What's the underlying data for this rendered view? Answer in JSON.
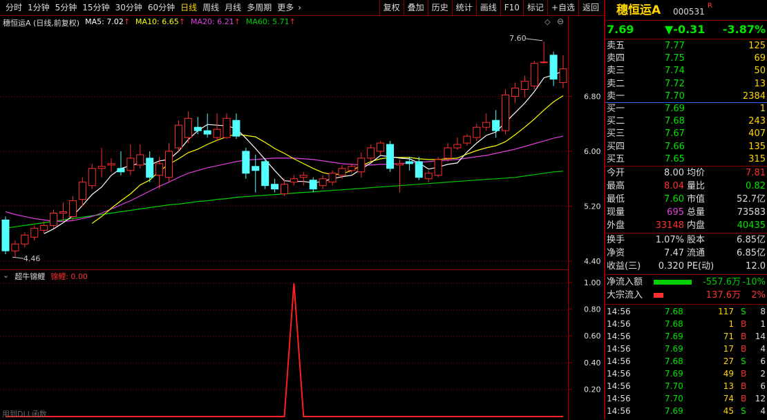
{
  "toolbar": {
    "periods": [
      "分时",
      "1分钟",
      "5分钟",
      "15分钟",
      "30分钟",
      "60分钟",
      "日线",
      "周线",
      "月线",
      "多周期",
      "更多"
    ],
    "active": "日线",
    "buttons": [
      "复权",
      "叠加",
      "历史",
      "统计",
      "画线",
      "F10",
      "标记",
      "+自选",
      "返回"
    ]
  },
  "main_legend": {
    "title": "穗恒运A (日线,前复权)",
    "ma5": "MA5: 7.02",
    "ma10": "MA10: 6.65",
    "ma20": "MA20: 6.21",
    "ma60": "MA60: 5.71",
    "arrow": "↑"
  },
  "sub_legend": {
    "title": "超牛锦鲤",
    "value": "锦鲤: 0.00"
  },
  "watermark": "用到DLL函数",
  "colors": {
    "up": "#ff3030",
    "down": "#54ffff",
    "ma5": "#ffffff",
    "ma10": "#ffff00",
    "ma20": "#e040e0",
    "ma60": "#00d000",
    "grid": "#8b0000"
  },
  "chart_data": [
    {
      "type": "candlestick",
      "title": "穗恒运A (日线,前复权)",
      "yticks": [
        6.8,
        6.0,
        5.2,
        4.4
      ],
      "ylim": [
        4.3,
        7.75
      ],
      "annotations": [
        {
          "label": "7.60"
        },
        {
          "label": "4.46"
        }
      ],
      "candles": [
        [
          5.0,
          4.55,
          5.05,
          4.5
        ],
        [
          4.55,
          4.65,
          4.7,
          4.46
        ],
        [
          4.65,
          4.78,
          4.82,
          4.6
        ],
        [
          4.75,
          4.88,
          4.92,
          4.7
        ],
        [
          4.85,
          4.92,
          4.98,
          4.8
        ],
        [
          4.92,
          5.1,
          5.15,
          4.88
        ],
        [
          5.1,
          5.12,
          5.25,
          5.0
        ],
        [
          5.05,
          5.28,
          5.35,
          5.0
        ],
        [
          5.3,
          5.55,
          5.62,
          5.2
        ],
        [
          5.5,
          5.75,
          5.82,
          5.45
        ],
        [
          5.75,
          5.78,
          6.05,
          5.62
        ],
        [
          5.8,
          5.82,
          5.9,
          5.7
        ],
        [
          5.75,
          5.7,
          6.0,
          5.65
        ],
        [
          5.72,
          5.9,
          6.1,
          5.65
        ],
        [
          5.8,
          5.95,
          6.1,
          5.75
        ],
        [
          5.9,
          5.62,
          6.0,
          5.55
        ],
        [
          5.65,
          5.82,
          5.92,
          5.45
        ],
        [
          5.62,
          6.0,
          6.12,
          5.55
        ],
        [
          6.05,
          6.38,
          6.45,
          6.0
        ],
        [
          6.2,
          6.48,
          6.58,
          6.12
        ],
        [
          6.35,
          6.3,
          6.5,
          6.25
        ],
        [
          6.3,
          6.25,
          6.55,
          6.2
        ],
        [
          6.2,
          6.32,
          6.55,
          6.15
        ],
        [
          6.2,
          6.48,
          6.55,
          6.18
        ],
        [
          6.45,
          6.22,
          6.55,
          6.18
        ],
        [
          6.0,
          5.68,
          6.05,
          5.6
        ],
        [
          5.78,
          5.72,
          5.95,
          5.4
        ],
        [
          5.85,
          5.5,
          5.9,
          5.45
        ],
        [
          5.52,
          5.45,
          5.6,
          5.4
        ],
        [
          5.38,
          5.52,
          5.6,
          5.35
        ],
        [
          5.55,
          5.6,
          5.65,
          5.5
        ],
        [
          5.62,
          5.65,
          5.7,
          5.5
        ],
        [
          5.58,
          5.45,
          5.62,
          5.4
        ],
        [
          5.5,
          5.6,
          5.65,
          5.45
        ],
        [
          5.55,
          5.68,
          5.72,
          5.5
        ],
        [
          5.65,
          5.75,
          5.8,
          5.6
        ],
        [
          5.72,
          5.78,
          5.82,
          5.68
        ],
        [
          5.7,
          5.9,
          5.98,
          5.62
        ],
        [
          5.9,
          6.05,
          6.1,
          5.85
        ],
        [
          6.0,
          6.12,
          6.15,
          5.95
        ],
        [
          6.1,
          5.75,
          6.15,
          5.7
        ],
        [
          5.8,
          5.82,
          5.88,
          5.4
        ],
        [
          5.85,
          5.82,
          5.92,
          5.72
        ],
        [
          5.85,
          5.62,
          5.92,
          5.58
        ],
        [
          5.6,
          5.68,
          5.72,
          5.55
        ],
        [
          5.65,
          5.88,
          5.92,
          5.62
        ],
        [
          5.9,
          6.05,
          6.12,
          5.85
        ],
        [
          6.05,
          6.1,
          6.2,
          6.02
        ],
        [
          6.12,
          6.22,
          6.25,
          6.08
        ],
        [
          6.2,
          6.35,
          6.4,
          6.15
        ],
        [
          6.35,
          6.42,
          6.55,
          6.3
        ],
        [
          6.45,
          6.3,
          6.6,
          6.2
        ],
        [
          6.3,
          6.82,
          6.9,
          6.25
        ],
        [
          6.8,
          6.92,
          7.0,
          6.7
        ],
        [
          6.9,
          7.02,
          7.1,
          6.78
        ],
        [
          6.95,
          7.28,
          7.32,
          6.9
        ],
        [
          7.3,
          7.3,
          7.6,
          7.28
        ],
        [
          7.4,
          7.05,
          7.45,
          6.95
        ],
        [
          7.0,
          7.2,
          7.4,
          6.92
        ]
      ],
      "ma5": [
        null,
        null,
        null,
        null,
        4.8,
        4.87,
        4.96,
        5.06,
        5.21,
        5.37,
        5.48,
        5.65,
        5.75,
        5.79,
        5.83,
        5.8,
        5.86,
        5.88,
        6.0,
        6.17,
        6.3,
        6.39,
        6.38,
        6.37,
        6.33,
        6.19,
        6.04,
        5.88,
        5.72,
        5.57,
        5.56,
        5.56,
        5.54,
        5.56,
        5.6,
        5.63,
        5.65,
        5.74,
        5.83,
        5.94,
        5.92,
        5.9,
        5.89,
        5.83,
        5.74,
        5.77,
        5.81,
        5.83,
        5.99,
        6.12,
        6.23,
        6.28,
        6.42,
        6.56,
        6.7,
        6.87,
        7.07,
        7.11,
        7.17
      ],
      "ma10": [
        null,
        null,
        null,
        null,
        null,
        null,
        null,
        null,
        null,
        4.95,
        5.05,
        5.17,
        5.28,
        5.38,
        5.51,
        5.58,
        5.71,
        5.81,
        5.89,
        5.98,
        6.03,
        6.1,
        6.16,
        6.21,
        6.25,
        6.23,
        6.21,
        6.13,
        6.04,
        5.97,
        5.89,
        5.82,
        5.75,
        5.69,
        5.66,
        5.67,
        5.72,
        5.79,
        5.85,
        5.89,
        5.91,
        5.91,
        5.91,
        5.89,
        5.88,
        5.88,
        5.89,
        5.9,
        5.96,
        6.01,
        6.05,
        6.08,
        6.14,
        6.24,
        6.35,
        6.47,
        6.6,
        6.72,
        6.81
      ],
      "ma20": [
        5.12,
        5.08,
        5.05,
        5.02,
        5.0,
        4.98,
        4.98,
        4.99,
        5.02,
        5.05,
        5.1,
        5.16,
        5.22,
        5.28,
        5.35,
        5.42,
        5.49,
        5.55,
        5.62,
        5.68,
        5.72,
        5.76,
        5.79,
        5.82,
        5.85,
        5.87,
        5.88,
        5.89,
        5.9,
        5.9,
        5.9,
        5.89,
        5.88,
        5.86,
        5.84,
        5.82,
        5.81,
        5.8,
        5.8,
        5.81,
        5.81,
        5.82,
        5.83,
        5.84,
        5.85,
        5.86,
        5.87,
        5.88,
        5.9,
        5.92,
        5.94,
        5.97,
        6.0,
        6.03,
        6.07,
        6.11,
        6.15,
        6.19,
        6.22
      ],
      "ma60": [
        4.88,
        4.9,
        4.92,
        4.94,
        4.96,
        4.98,
        5.0,
        5.02,
        5.04,
        5.06,
        5.08,
        5.1,
        5.12,
        5.14,
        5.16,
        5.18,
        5.2,
        5.22,
        5.23,
        5.25,
        5.27,
        5.28,
        5.3,
        5.31,
        5.33,
        5.34,
        5.35,
        5.36,
        5.37,
        5.38,
        5.39,
        5.4,
        5.41,
        5.42,
        5.43,
        5.44,
        5.45,
        5.46,
        5.47,
        5.48,
        5.49,
        5.5,
        5.51,
        5.52,
        5.53,
        5.54,
        5.55,
        5.56,
        5.57,
        5.58,
        5.59,
        5.6,
        5.61,
        5.62,
        5.64,
        5.66,
        5.68,
        5.7,
        5.71
      ]
    },
    {
      "type": "line",
      "title": "超牛锦鲤",
      "yticks": [
        1.0,
        0.8,
        0.6,
        0.4,
        0.2
      ],
      "ylim": [
        0,
        1.0
      ],
      "series": [
        {
          "name": "锦鲤",
          "values": [
            0,
            0,
            0,
            0,
            0,
            0,
            0,
            0,
            0,
            0,
            0,
            0,
            0,
            0,
            0,
            0,
            0,
            0,
            0,
            0,
            0,
            0,
            0,
            0,
            0,
            0,
            0,
            0,
            0,
            0,
            1,
            0,
            0,
            0,
            0,
            0,
            0,
            0,
            0,
            0,
            0,
            0,
            0,
            0,
            0,
            0,
            0,
            0,
            0,
            0,
            0,
            0,
            0,
            0,
            0,
            0,
            0,
            0,
            0
          ]
        }
      ]
    }
  ],
  "panel": {
    "name": "穗恒运A",
    "code": "000531",
    "r_mark": "R",
    "price": "7.69",
    "change": "▼-0.31",
    "pct": "-3.87%",
    "asks": [
      {
        "label": "卖五",
        "price": "7.77",
        "vol": "125"
      },
      {
        "label": "卖四",
        "price": "7.75",
        "vol": "69"
      },
      {
        "label": "卖三",
        "price": "7.74",
        "vol": "50"
      },
      {
        "label": "卖二",
        "price": "7.72",
        "vol": "13"
      },
      {
        "label": "卖一",
        "price": "7.70",
        "vol": "2384"
      }
    ],
    "bids": [
      {
        "label": "买一",
        "price": "7.69",
        "vol": "1"
      },
      {
        "label": "买二",
        "price": "7.68",
        "vol": "243"
      },
      {
        "label": "买三",
        "price": "7.67",
        "vol": "407"
      },
      {
        "label": "买四",
        "price": "7.66",
        "vol": "135"
      },
      {
        "label": "买五",
        "price": "7.65",
        "vol": "315"
      }
    ],
    "stats": [
      {
        "l1": "今开",
        "v1": "8.00",
        "c1": "c-white",
        "l2": "均价",
        "v2": "7.81",
        "c2": "c-red"
      },
      {
        "l1": "最高",
        "v1": "8.04",
        "c1": "c-red",
        "l2": "量比",
        "v2": "0.82",
        "c2": "c-green"
      },
      {
        "l1": "最低",
        "v1": "7.60",
        "c1": "c-green",
        "l2": "市值",
        "v2": "52.7亿",
        "c2": "c-white"
      },
      {
        "l1": "现量",
        "v1": "695",
        "c1": "c-magenta",
        "l2": "总量",
        "v2": "73583",
        "c2": "c-white"
      },
      {
        "l1": "外盘",
        "v1": "33148",
        "c1": "c-red",
        "l2": "内盘",
        "v2": "40435",
        "c2": "c-green"
      }
    ],
    "stats2": [
      {
        "l1": "换手",
        "v1": "1.07%",
        "l2": "股本",
        "v2": "6.85亿"
      },
      {
        "l1": "净资",
        "v1": "7.47",
        "l2": "流通",
        "v2": "6.85亿"
      },
      {
        "l1": "收益(三)",
        "v1": "0.320",
        "l2": "PE(动)",
        "v2": "12.0"
      }
    ],
    "flows": [
      {
        "label": "净流入额",
        "value": "-557.6万",
        "pct": "-10%",
        "color": "#00d000"
      },
      {
        "label": "大宗流入",
        "value": "137.6万",
        "pct": "2%",
        "color": "#ff3030"
      }
    ],
    "ticks": [
      {
        "time": "14:56",
        "price": "7.68",
        "vol": "117",
        "side": "S",
        "n": "8"
      },
      {
        "time": "14:56",
        "price": "7.68",
        "vol": "1",
        "side": "B",
        "n": "1"
      },
      {
        "time": "14:56",
        "price": "7.69",
        "vol": "71",
        "side": "B",
        "n": "14"
      },
      {
        "time": "14:56",
        "price": "7.69",
        "vol": "17",
        "side": "B",
        "n": "4"
      },
      {
        "time": "14:56",
        "price": "7.68",
        "vol": "27",
        "side": "S",
        "n": "6"
      },
      {
        "time": "14:56",
        "price": "7.69",
        "vol": "49",
        "side": "B",
        "n": "2"
      },
      {
        "time": "14:56",
        "price": "7.70",
        "vol": "13",
        "side": "B",
        "n": "6"
      },
      {
        "time": "14:56",
        "price": "7.70",
        "vol": "74",
        "side": "B",
        "n": "12"
      },
      {
        "time": "14:56",
        "price": "7.69",
        "vol": "45",
        "side": "S",
        "n": "4"
      }
    ]
  }
}
